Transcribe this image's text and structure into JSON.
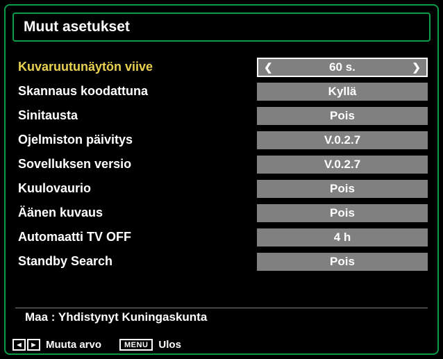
{
  "title": "Muut asetukset",
  "settings": [
    {
      "label": "Kuvaruutunäytön viive",
      "value": "60 s.",
      "selected": true,
      "hasArrows": true
    },
    {
      "label": "Skannaus koodattuna",
      "value": "Kyllä",
      "selected": false,
      "hasArrows": false
    },
    {
      "label": "Sinitausta",
      "value": "Pois",
      "selected": false,
      "hasArrows": false
    },
    {
      "label": "Ojelmiston päivitys",
      "value": "V.0.2.7",
      "selected": false,
      "hasArrows": false
    },
    {
      "label": "Sovelluksen versio",
      "value": "V.0.2.7",
      "selected": false,
      "hasArrows": false
    },
    {
      "label": "Kuulovaurio",
      "value": "Pois",
      "selected": false,
      "hasArrows": false
    },
    {
      "label": "Äänen kuvaus",
      "value": "Pois",
      "selected": false,
      "hasArrows": false
    },
    {
      "label": "Automaatti TV OFF",
      "value": "4 h",
      "selected": false,
      "hasArrows": false
    },
    {
      "label": "Standby Search",
      "value": "Pois",
      "selected": false,
      "hasArrows": false
    }
  ],
  "country": "Maa : Yhdistynyt Kuningaskunta",
  "footer": {
    "navLeft": "◄",
    "navRight": "►",
    "changeValue": "Muuta arvo",
    "menuLabel": "MENU",
    "exit": "Ulos"
  }
}
